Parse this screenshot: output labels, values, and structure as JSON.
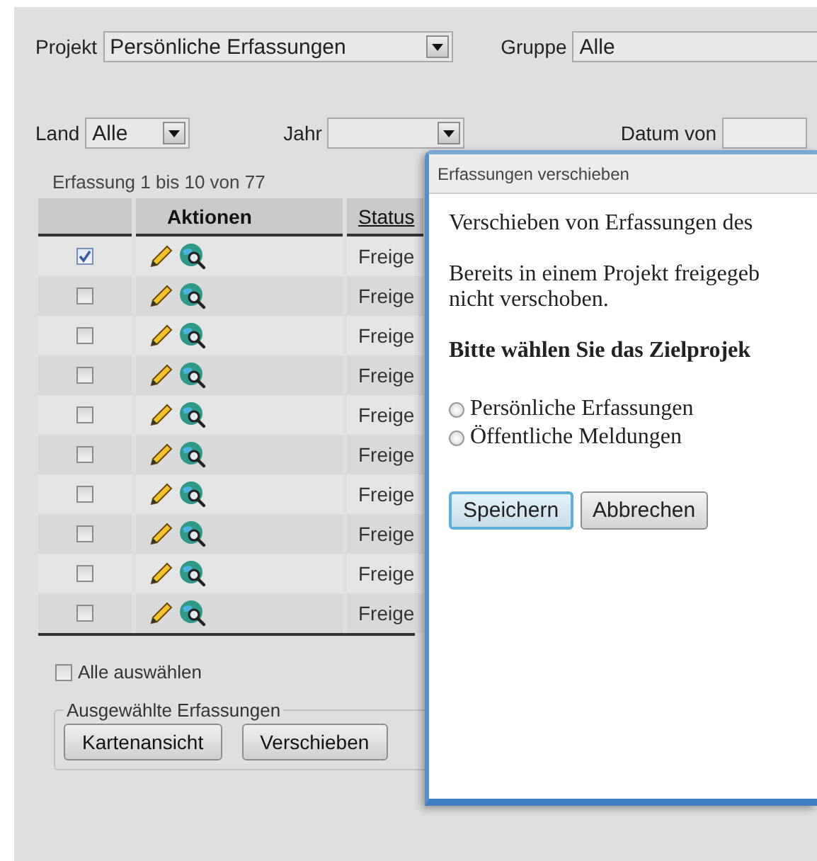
{
  "filter_rows": [
    [
      {
        "kind": "select",
        "label": "Projekt",
        "value": "Persönliche Erfassungen"
      },
      {
        "kind": "select",
        "label": "Gruppe",
        "value": "Alle"
      }
    ],
    [
      {
        "kind": "select",
        "label": "Land",
        "value": "Alle"
      },
      {
        "kind": "select",
        "label": "Jahr"
      },
      {
        "kind": "field",
        "label": "Datum von"
      }
    ]
  ],
  "pager": "Erfassung 1 bis 10 von 77",
  "table": {
    "columns": [
      "Aktionen",
      "Status"
    ],
    "rows": [
      {
        "checked": true,
        "status": "Freige"
      },
      {
        "checked": false,
        "status": "Freige"
      },
      {
        "checked": false,
        "status": "Freige"
      },
      {
        "checked": false,
        "status": "Freige"
      },
      {
        "checked": false,
        "status": "Freige"
      },
      {
        "checked": false,
        "status": "Freige"
      },
      {
        "checked": false,
        "status": "Freige"
      },
      {
        "checked": false,
        "status": "Freige"
      },
      {
        "checked": false,
        "status": "Freige"
      },
      {
        "checked": false,
        "status": "Freige"
      }
    ]
  },
  "select_all": {
    "label": "Alle auswählen",
    "checked": false
  },
  "selection_group": {
    "legend": "Ausgewählte Erfassungen",
    "buttons": [
      "Kartenansicht",
      "Verschieben"
    ]
  },
  "dialog": {
    "title": "Erfassungen verschieben",
    "paragraphs": [
      "Verschieben von Erfassungen des",
      "Bereits in einem Projekt freigegeb\nnicht verschoben."
    ],
    "prompt": "Bitte wählen Sie das Zielprojek",
    "options": [
      {
        "label": "Persönliche Erfassungen",
        "selected": false
      },
      {
        "label": "Öffentliche Meldungen",
        "selected": false
      }
    ],
    "buttons": [
      {
        "label": "Speichern",
        "focused": true
      },
      {
        "label": "Abbrechen",
        "focused": false
      }
    ]
  }
}
